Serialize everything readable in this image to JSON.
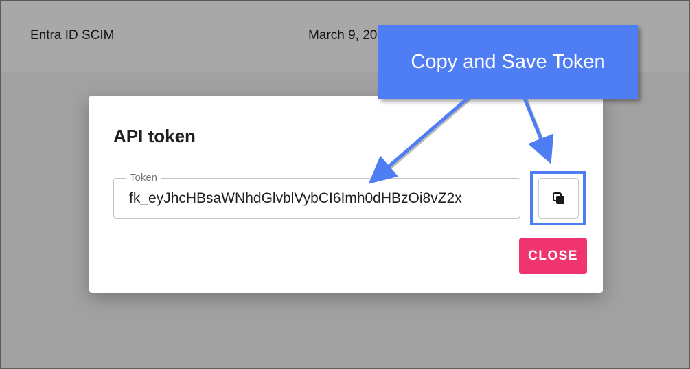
{
  "background": {
    "row": {
      "name": "Entra ID SCIM",
      "date": "March 9, 20"
    }
  },
  "dialog": {
    "title": "API token",
    "token_field": {
      "label": "Token",
      "value": "fk_eyJhcHBsaWNhdGlvblVybCI6Imh0dHBzOi8vZ2x"
    },
    "copy_button": {
      "icon": "copy-icon"
    },
    "close_label": "CLOSE"
  },
  "annotation": {
    "callout_text": "Copy and Save Token",
    "color": "#4f7df3"
  },
  "colors": {
    "close_button": "#f0346f",
    "callout": "#4f7df3"
  }
}
